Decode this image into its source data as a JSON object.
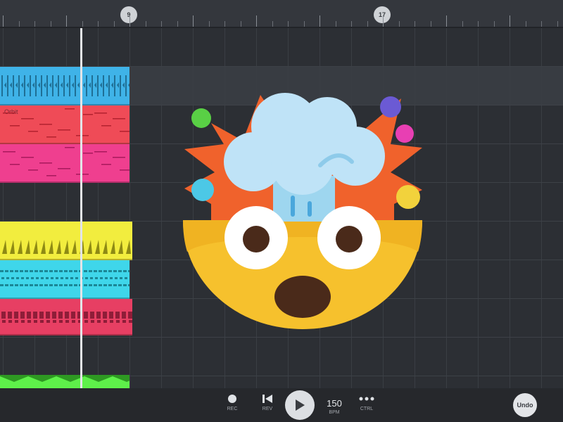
{
  "ruler": {
    "markers": [
      {
        "label": "9"
      },
      {
        "label": "17"
      }
    ]
  },
  "tracks": [
    {
      "name": "",
      "color": "#3fb3e8"
    },
    {
      "name": "Orbit",
      "color": "#ef4b57"
    },
    {
      "name": "",
      "color": "#ef3f8f"
    },
    {
      "name": "",
      "color": "#f2ed3e"
    },
    {
      "name": "",
      "color": "#3fd6ea"
    },
    {
      "name": "",
      "color": "#e73f63"
    },
    {
      "name": "",
      "color": "#5ef04a"
    }
  ],
  "overlay": {
    "icon": "exploding-head-emoji"
  },
  "transport": {
    "rec_label": "REC",
    "rev_label": "REV",
    "bpm_value": "150",
    "bpm_label": "BPM",
    "ctrl_label": "CTRL",
    "undo_label": "Undo"
  }
}
